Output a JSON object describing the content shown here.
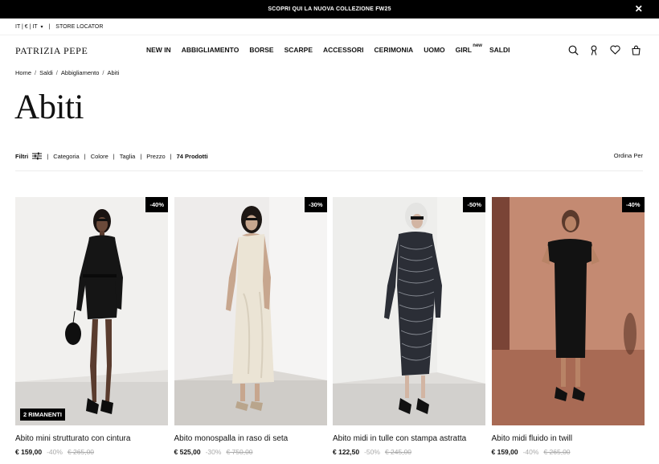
{
  "promo": {
    "text": "SCOPRI QUI LA NUOVA COLLEZIONE FW25",
    "close_icon": "close-icon"
  },
  "utility": {
    "locale": "IT | € | IT",
    "chevron_icon": "chevron-down-icon",
    "store_locator": "STORE LOCATOR"
  },
  "brand": {
    "logo": "PATRIZIA PEPE"
  },
  "nav": {
    "items": [
      "NEW IN",
      "ABBIGLIAMENTO",
      "BORSE",
      "SCARPE",
      "ACCESSORI",
      "CERIMONIA",
      "UOMO",
      "GIRL",
      "SALDI"
    ],
    "girl_badge": "new"
  },
  "header_icons": [
    "search-icon",
    "account-icon",
    "wishlist-heart-icon",
    "cart-bag-icon"
  ],
  "breadcrumb": [
    "Home",
    "Saldi",
    "Abbigliamento",
    "Abiti"
  ],
  "page": {
    "title": "Abiti"
  },
  "filters": {
    "label": "Filtri",
    "options": [
      "Categoria",
      "Colore",
      "Taglia",
      "Prezzo"
    ],
    "count": "74 Prodotti",
    "sort": "Ordina Per"
  },
  "products": [
    {
      "name": "Abito mini strutturato con cintura",
      "discount": "-40%",
      "stock": "2 RIMANENTI",
      "price": "€ 159,00",
      "pct": "-40%",
      "was": "€ 265,00"
    },
    {
      "name": "Abito monospalla in raso di seta",
      "discount": "-30%",
      "stock": "",
      "price": "€ 525,00",
      "pct": "-30%",
      "was": "€ 750,00"
    },
    {
      "name": "Abito midi in tulle con stampa astratta",
      "discount": "-50%",
      "stock": "",
      "price": "€ 122,50",
      "pct": "-50%",
      "was": "€ 245,00"
    },
    {
      "name": "Abito midi fluido in twill",
      "discount": "-40%",
      "stock": "",
      "price": "€ 159,00",
      "pct": "-40%",
      "was": "€ 265,00"
    }
  ],
  "colors": {
    "promo_bg": "#000000",
    "accent": "#111111",
    "muted": "#aaaaaa"
  }
}
